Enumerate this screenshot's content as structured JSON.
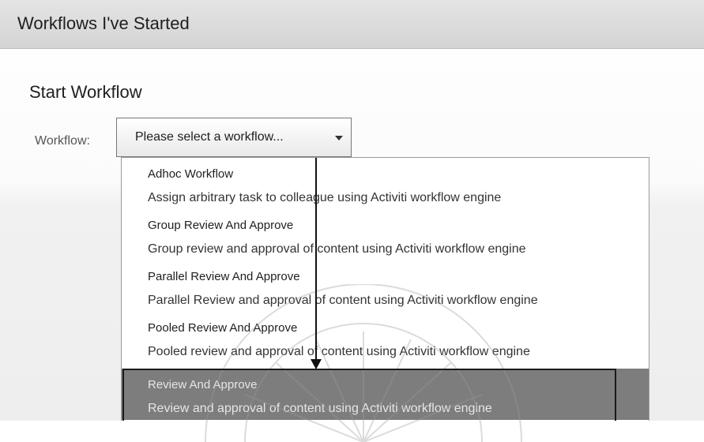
{
  "header": {
    "title": "Workflows I've Started"
  },
  "form": {
    "section_title": "Start Workflow",
    "workflow_label": "Workflow:",
    "select_placeholder": "Please select a workflow..."
  },
  "dropdown": {
    "options": [
      {
        "name": "Adhoc Workflow",
        "description": "Assign arbitrary task to colleague using Activiti workflow engine"
      },
      {
        "name": "Group Review And Approve",
        "description": "Group review and approval of content using Activiti workflow engine"
      },
      {
        "name": "Parallel Review And Approve",
        "description": "Parallel Review and approval of content using Activiti workflow engine"
      },
      {
        "name": "Pooled Review And Approve",
        "description": "Pooled review and approval of content using Activiti workflow engine"
      },
      {
        "name": "Review And Approve",
        "description": "Review and approval of content using Activiti workflow engine"
      }
    ],
    "highlighted_option": "Review And Approve"
  },
  "colors": {
    "header_bg": "#d9d9d9",
    "selected_option_bg": "#7d7d7d",
    "annotation": "#111111"
  },
  "icons": {
    "select_caret": "caret-down-icon"
  }
}
